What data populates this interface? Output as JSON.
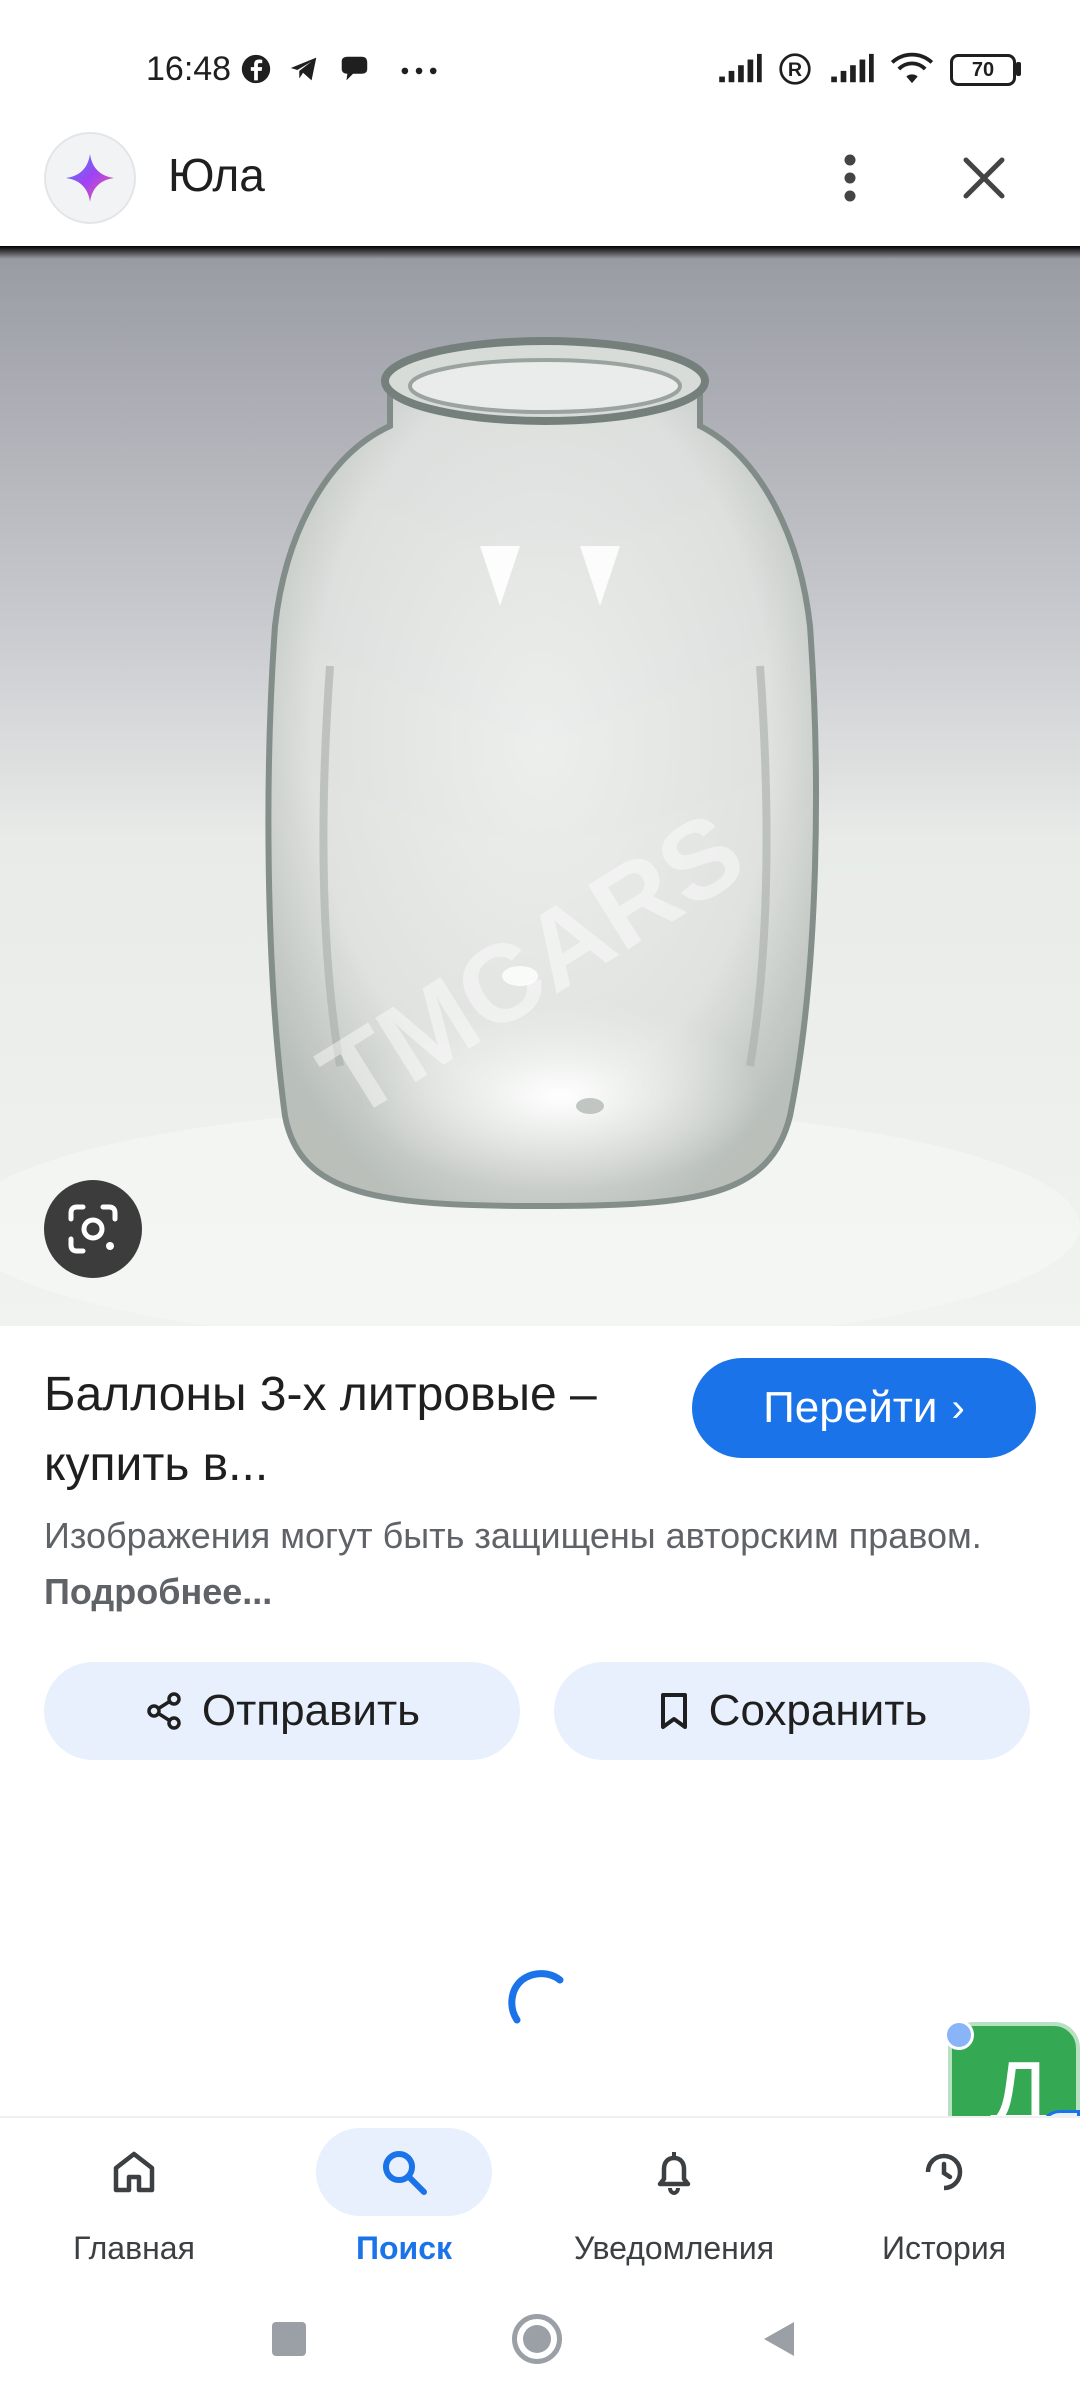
{
  "status_bar": {
    "time": "16:48",
    "battery": "70",
    "icons": [
      "facebook-icon",
      "telegram-icon",
      "chat-icon",
      "more-notifications-icon",
      "signal-icon",
      "roaming-icon",
      "signal-icon",
      "wifi-icon",
      "battery-icon"
    ]
  },
  "header": {
    "title": "Юла",
    "logo": "sparkle-icon"
  },
  "image": {
    "watermark": "TMCARS"
  },
  "result": {
    "title": "Баллоны 3-х литровые – купить в...",
    "visit_label": "Перейти",
    "copyright_text": "Изображения могут быть защищены авторским правом.",
    "more_link": "Подробнее..."
  },
  "actions": {
    "share_label": "Отправить",
    "save_label": "Сохранить"
  },
  "floating": {
    "letter": "Д"
  },
  "bottom_nav": {
    "home": "Главная",
    "search": "Поиск",
    "notifications": "Уведомления",
    "history": "История"
  },
  "colors": {
    "accent": "#1a73e8",
    "chip": "#e8f0fe",
    "widget": "#34a853"
  }
}
